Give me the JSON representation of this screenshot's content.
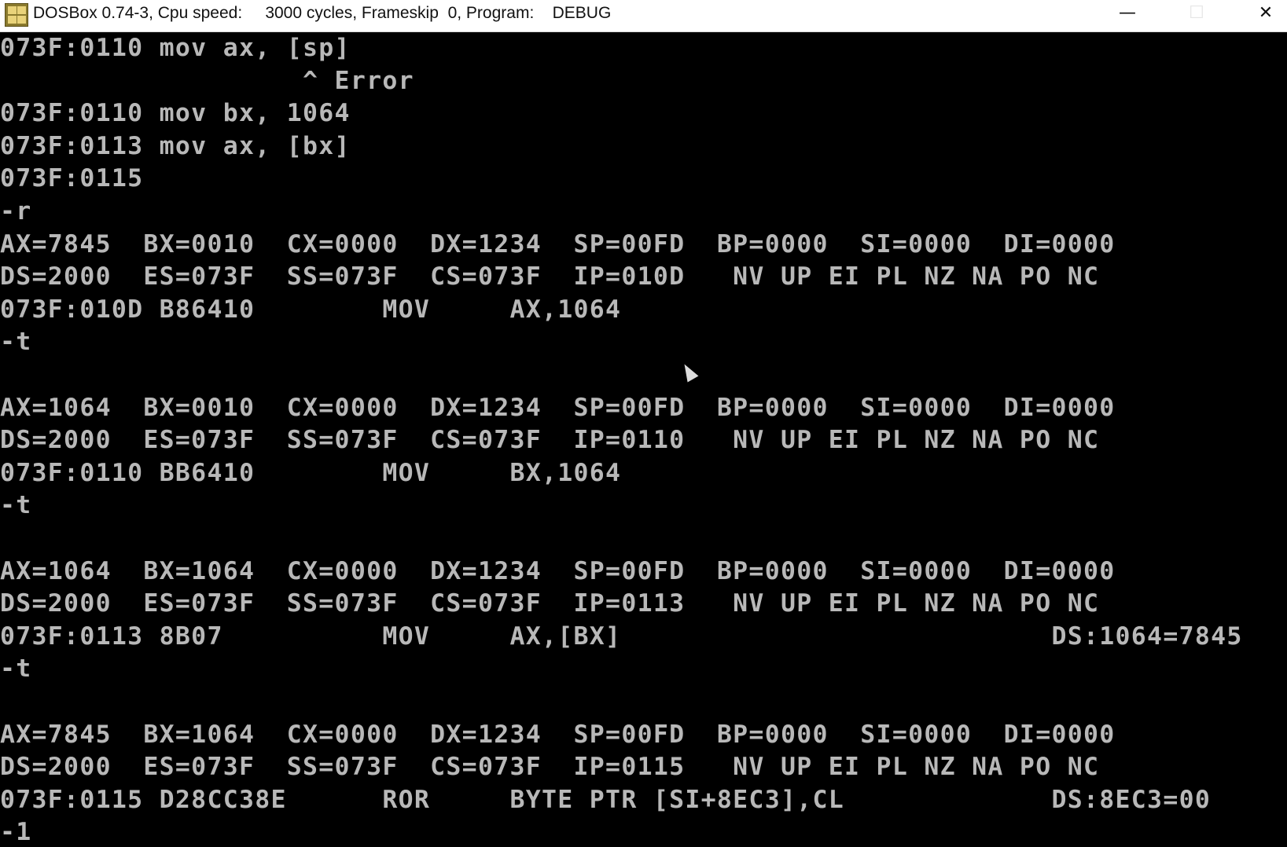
{
  "window": {
    "title": "DOSBox 0.74-3, Cpu speed:     3000 cycles, Frameskip  0, Program:    DEBUG",
    "minimize_label": "—",
    "maximize_label": "☐",
    "close_label": "✕"
  },
  "console": {
    "lines": [
      "073F:0110 mov ax, [sp]",
      "                   ^ Error",
      "073F:0110 mov bx, 1064",
      "073F:0113 mov ax, [bx]",
      "073F:0115",
      "-r",
      "AX=7845  BX=0010  CX=0000  DX=1234  SP=00FD  BP=0000  SI=0000  DI=0000",
      "DS=2000  ES=073F  SS=073F  CS=073F  IP=010D   NV UP EI PL NZ NA PO NC",
      "073F:010D B86410        MOV     AX,1064",
      "-t",
      "",
      "AX=1064  BX=0010  CX=0000  DX=1234  SP=00FD  BP=0000  SI=0000  DI=0000",
      "DS=2000  ES=073F  SS=073F  CS=073F  IP=0110   NV UP EI PL NZ NA PO NC",
      "073F:0110 BB6410        MOV     BX,1064",
      "-t",
      "",
      "AX=1064  BX=1064  CX=0000  DX=1234  SP=00FD  BP=0000  SI=0000  DI=0000",
      "DS=2000  ES=073F  SS=073F  CS=073F  IP=0113   NV UP EI PL NZ NA PO NC",
      "073F:0113 8B07          MOV     AX,[BX]                           DS:1064=7845",
      "-t",
      "",
      "AX=7845  BX=1064  CX=0000  DX=1234  SP=00FD  BP=0000  SI=0000  DI=0000",
      "DS=2000  ES=073F  SS=073F  CS=073F  IP=0115   NV UP EI PL NZ NA PO NC",
      "073F:0115 D28CC38E      ROR     BYTE PTR [SI+8EC3],CL             DS:8EC3=00",
      "-1"
    ]
  }
}
